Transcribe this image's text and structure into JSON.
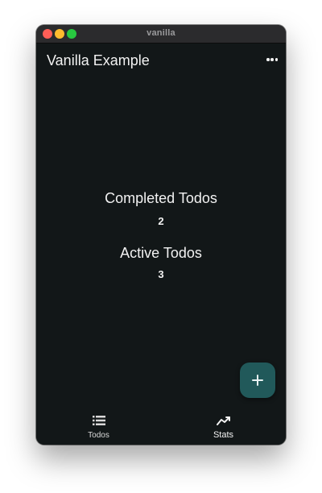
{
  "window": {
    "title": "vanilla"
  },
  "appbar": {
    "title": "Vanilla Example",
    "menu_icon": "more-horizontal-icon"
  },
  "stats": {
    "completed_label": "Completed Todos",
    "completed_value": "2",
    "active_label": "Active Todos",
    "active_value": "3"
  },
  "fab": {
    "icon": "plus-icon"
  },
  "bottom_nav": {
    "items": [
      {
        "label": "Todos",
        "icon": "list-icon",
        "selected": false
      },
      {
        "label": "Stats",
        "icon": "trending-up-icon",
        "selected": true
      }
    ]
  },
  "colors": {
    "background": "#121718",
    "fab": "#21595a",
    "text": "#f2f2f2"
  }
}
